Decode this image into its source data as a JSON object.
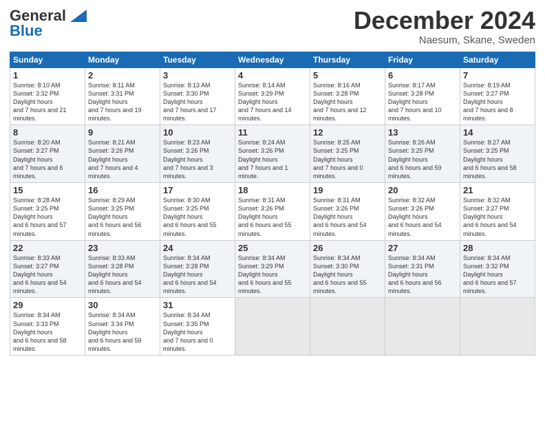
{
  "logo": {
    "line1": "General",
    "line2": "Blue"
  },
  "header": {
    "month": "December 2024",
    "location": "Naesum, Skane, Sweden"
  },
  "weekdays": [
    "Sunday",
    "Monday",
    "Tuesday",
    "Wednesday",
    "Thursday",
    "Friday",
    "Saturday"
  ],
  "weeks": [
    [
      {
        "day": "1",
        "sunrise": "8:10 AM",
        "sunset": "3:32 PM",
        "daylight": "7 hours and 21 minutes."
      },
      {
        "day": "2",
        "sunrise": "8:11 AM",
        "sunset": "3:31 PM",
        "daylight": "7 hours and 19 minutes."
      },
      {
        "day": "3",
        "sunrise": "8:13 AM",
        "sunset": "3:30 PM",
        "daylight": "7 hours and 17 minutes."
      },
      {
        "day": "4",
        "sunrise": "8:14 AM",
        "sunset": "3:29 PM",
        "daylight": "7 hours and 14 minutes."
      },
      {
        "day": "5",
        "sunrise": "8:16 AM",
        "sunset": "3:28 PM",
        "daylight": "7 hours and 12 minutes."
      },
      {
        "day": "6",
        "sunrise": "8:17 AM",
        "sunset": "3:28 PM",
        "daylight": "7 hours and 10 minutes."
      },
      {
        "day": "7",
        "sunrise": "8:19 AM",
        "sunset": "3:27 PM",
        "daylight": "7 hours and 8 minutes."
      }
    ],
    [
      {
        "day": "8",
        "sunrise": "8:20 AM",
        "sunset": "3:27 PM",
        "daylight": "7 hours and 6 minutes."
      },
      {
        "day": "9",
        "sunrise": "8:21 AM",
        "sunset": "3:26 PM",
        "daylight": "7 hours and 4 minutes."
      },
      {
        "day": "10",
        "sunrise": "8:23 AM",
        "sunset": "3:26 PM",
        "daylight": "7 hours and 3 minutes."
      },
      {
        "day": "11",
        "sunrise": "8:24 AM",
        "sunset": "3:26 PM",
        "daylight": "7 hours and 1 minute."
      },
      {
        "day": "12",
        "sunrise": "8:25 AM",
        "sunset": "3:25 PM",
        "daylight": "7 hours and 0 minutes."
      },
      {
        "day": "13",
        "sunrise": "8:26 AM",
        "sunset": "3:25 PM",
        "daylight": "6 hours and 59 minutes."
      },
      {
        "day": "14",
        "sunrise": "8:27 AM",
        "sunset": "3:25 PM",
        "daylight": "6 hours and 58 minutes."
      }
    ],
    [
      {
        "day": "15",
        "sunrise": "8:28 AM",
        "sunset": "3:25 PM",
        "daylight": "6 hours and 57 minutes."
      },
      {
        "day": "16",
        "sunrise": "8:29 AM",
        "sunset": "3:25 PM",
        "daylight": "6 hours and 56 minutes."
      },
      {
        "day": "17",
        "sunrise": "8:30 AM",
        "sunset": "3:25 PM",
        "daylight": "6 hours and 55 minutes."
      },
      {
        "day": "18",
        "sunrise": "8:31 AM",
        "sunset": "3:26 PM",
        "daylight": "6 hours and 55 minutes."
      },
      {
        "day": "19",
        "sunrise": "8:31 AM",
        "sunset": "3:26 PM",
        "daylight": "6 hours and 54 minutes."
      },
      {
        "day": "20",
        "sunrise": "8:32 AM",
        "sunset": "3:26 PM",
        "daylight": "6 hours and 54 minutes."
      },
      {
        "day": "21",
        "sunrise": "8:32 AM",
        "sunset": "3:27 PM",
        "daylight": "6 hours and 54 minutes."
      }
    ],
    [
      {
        "day": "22",
        "sunrise": "8:33 AM",
        "sunset": "3:27 PM",
        "daylight": "6 hours and 54 minutes."
      },
      {
        "day": "23",
        "sunrise": "8:33 AM",
        "sunset": "3:28 PM",
        "daylight": "6 hours and 54 minutes."
      },
      {
        "day": "24",
        "sunrise": "8:34 AM",
        "sunset": "3:28 PM",
        "daylight": "6 hours and 54 minutes."
      },
      {
        "day": "25",
        "sunrise": "8:34 AM",
        "sunset": "3:29 PM",
        "daylight": "6 hours and 55 minutes."
      },
      {
        "day": "26",
        "sunrise": "8:34 AM",
        "sunset": "3:30 PM",
        "daylight": "6 hours and 55 minutes."
      },
      {
        "day": "27",
        "sunrise": "8:34 AM",
        "sunset": "3:31 PM",
        "daylight": "6 hours and 56 minutes."
      },
      {
        "day": "28",
        "sunrise": "8:34 AM",
        "sunset": "3:32 PM",
        "daylight": "6 hours and 57 minutes."
      }
    ],
    [
      {
        "day": "29",
        "sunrise": "8:34 AM",
        "sunset": "3:33 PM",
        "daylight": "6 hours and 58 minutes."
      },
      {
        "day": "30",
        "sunrise": "8:34 AM",
        "sunset": "3:34 PM",
        "daylight": "6 hours and 59 minutes."
      },
      {
        "day": "31",
        "sunrise": "8:34 AM",
        "sunset": "3:35 PM",
        "daylight": "7 hours and 0 minutes."
      },
      null,
      null,
      null,
      null
    ]
  ]
}
